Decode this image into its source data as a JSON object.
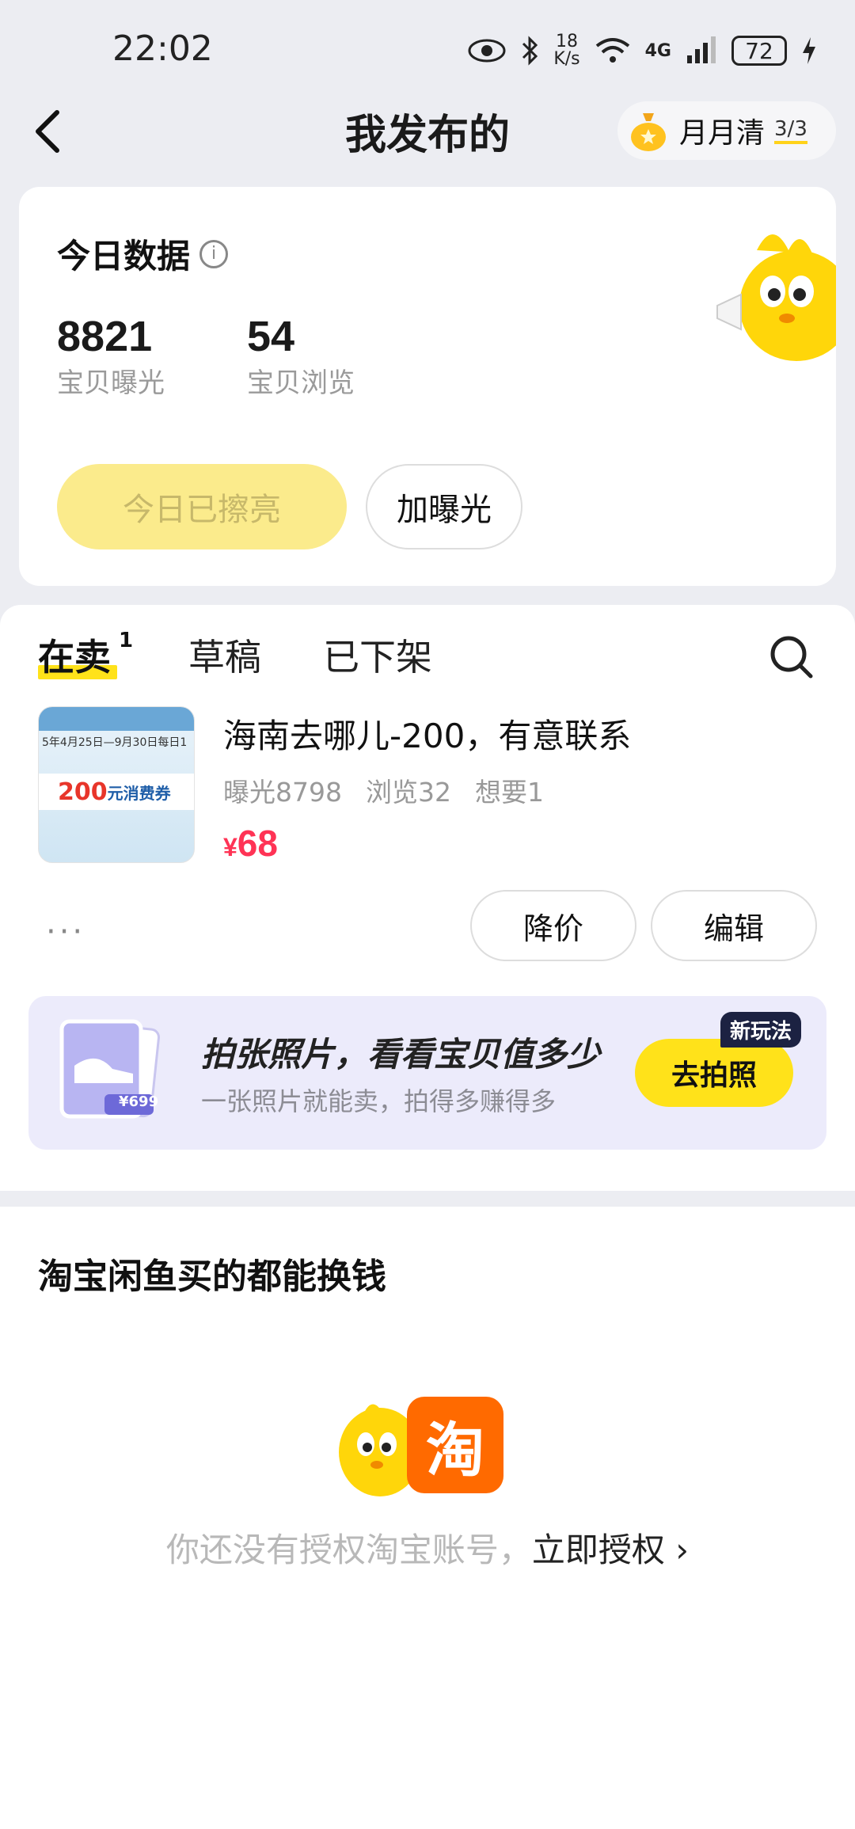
{
  "status_bar": {
    "time": "22:02",
    "speed_value": "18",
    "speed_unit": "K/s",
    "network": "4G",
    "battery": "72"
  },
  "header": {
    "title": "我发布的",
    "monthly_label": "月月清",
    "monthly_count": "3/3"
  },
  "today": {
    "title": "今日数据",
    "stats": [
      {
        "value": "8821",
        "label": "宝贝曝光"
      },
      {
        "value": "54",
        "label": "宝贝浏览"
      }
    ],
    "polished_label": "今日已擦亮",
    "boost_label": "加曝光"
  },
  "tabs": {
    "items": [
      {
        "label": "在卖",
        "badge": "1",
        "active": true
      },
      {
        "label": "草稿",
        "active": false
      },
      {
        "label": "已下架",
        "active": false
      }
    ]
  },
  "item": {
    "title": "海南去哪儿-200，有意联系",
    "stats": [
      "曝光8798",
      "浏览32",
      "想要1"
    ],
    "currency": "¥",
    "price": "68",
    "more": "···",
    "reduce_label": "降价",
    "edit_label": "编辑",
    "thumb_amount": "200",
    "thumb_unit": "元消费券",
    "thumb_line": "5年4月25日—9月30日每日1"
  },
  "promo": {
    "title": "拍张照片，看看宝贝值多少",
    "subtitle": "一张照片就能卖，拍得多赚得多",
    "button": "去拍照",
    "badge": "新玩法",
    "tag_price": "¥699"
  },
  "taobao": {
    "title": "淘宝闲鱼买的都能换钱",
    "logo_char": "淘",
    "prompt": "你还没有授权淘宝账号，",
    "link": "立即授权",
    "chevron": "›"
  },
  "colors": {
    "accent_yellow": "#ffe21a",
    "price_red": "#ff3355",
    "taobao_orange": "#ff6a00"
  }
}
